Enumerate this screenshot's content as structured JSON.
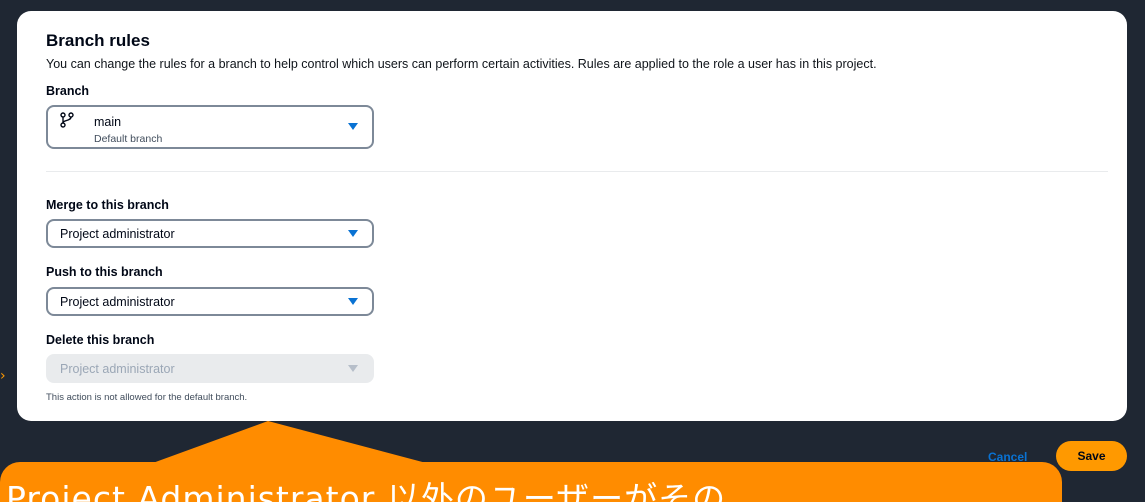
{
  "colors": {
    "accent": "#ff9900",
    "link": "#0972d3",
    "callout": "#ff8c00",
    "background": "#1f2733"
  },
  "page_arrow_glyph": "›",
  "panel": {
    "title": "Branch rules",
    "description": "You can change the rules for a branch to help control which users can perform certain activities. Rules are applied to the role a user has in this project.",
    "branch": {
      "label": "Branch",
      "icon": "git-branch-icon",
      "value": "main",
      "sublabel": "Default branch"
    },
    "merge": {
      "label": "Merge to this branch",
      "value": "Project administrator"
    },
    "push": {
      "label": "Push to this branch",
      "value": "Project administrator"
    },
    "delete": {
      "label": "Delete this branch",
      "value": "Project administrator",
      "disabled": true,
      "hint": "This action is not allowed for the default branch."
    }
  },
  "actions": {
    "cancel_label": "Cancel",
    "save_label": "Save"
  },
  "callout": {
    "text": "Project Administrator 以外のユーザーがその"
  }
}
